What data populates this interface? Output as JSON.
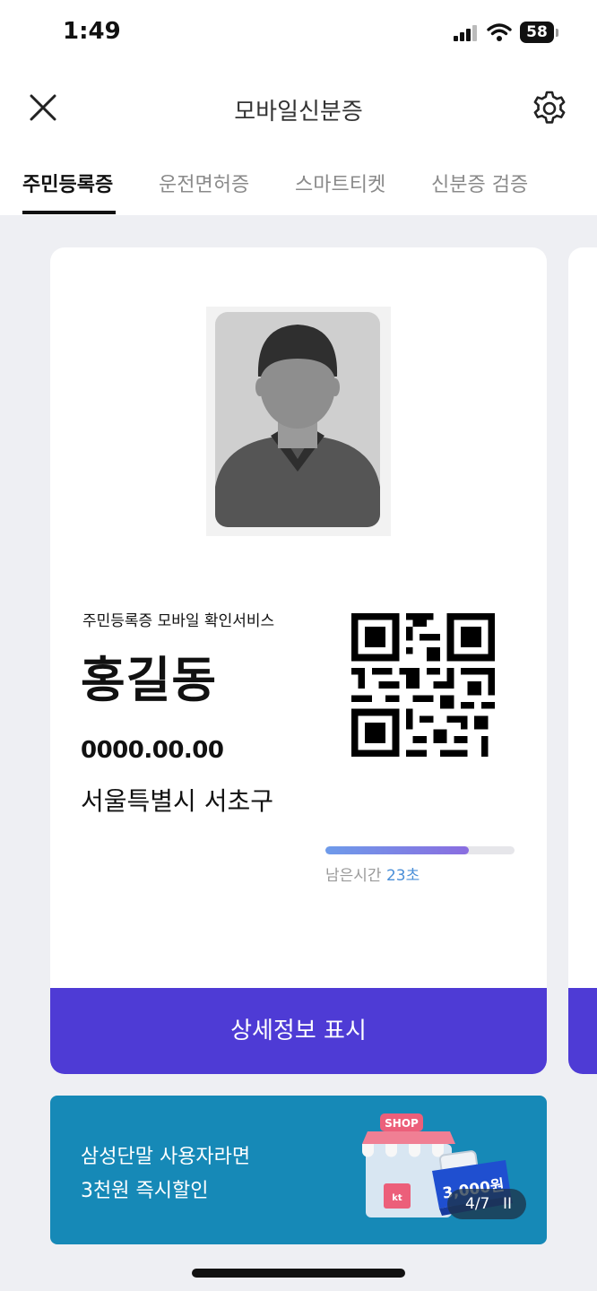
{
  "status_bar": {
    "time": "1:49",
    "battery": "58"
  },
  "header": {
    "title": "모바일신분증",
    "close_icon": "close-icon",
    "settings_icon": "gear-icon"
  },
  "tabs": [
    {
      "label": "주민등록증",
      "active": true
    },
    {
      "label": "운전면허증",
      "active": false
    },
    {
      "label": "스마트티켓",
      "active": false
    },
    {
      "label": "신분증 검증",
      "active": false
    }
  ],
  "id_card": {
    "service_label": "주민등록증 모바일 확인서비스",
    "name": "홍길동",
    "birth_date": "0000.00.00",
    "address": "서울특별시 서초구",
    "timer_label": "남은시간",
    "timer_value": "23초",
    "timer_progress": 0.76,
    "detail_button": "상세정보 표시"
  },
  "banner": {
    "line1": "삼성단말 사용자라면",
    "line2": "3천원 즉시할인",
    "art_shop": "SHOP",
    "art_coupon": "3,000원",
    "pager": "4/7",
    "pager_pause": "II"
  },
  "colors": {
    "accent": "#4e3bd5",
    "banner_bg": "#1689b7",
    "timer_text": "#4a8fd8"
  }
}
